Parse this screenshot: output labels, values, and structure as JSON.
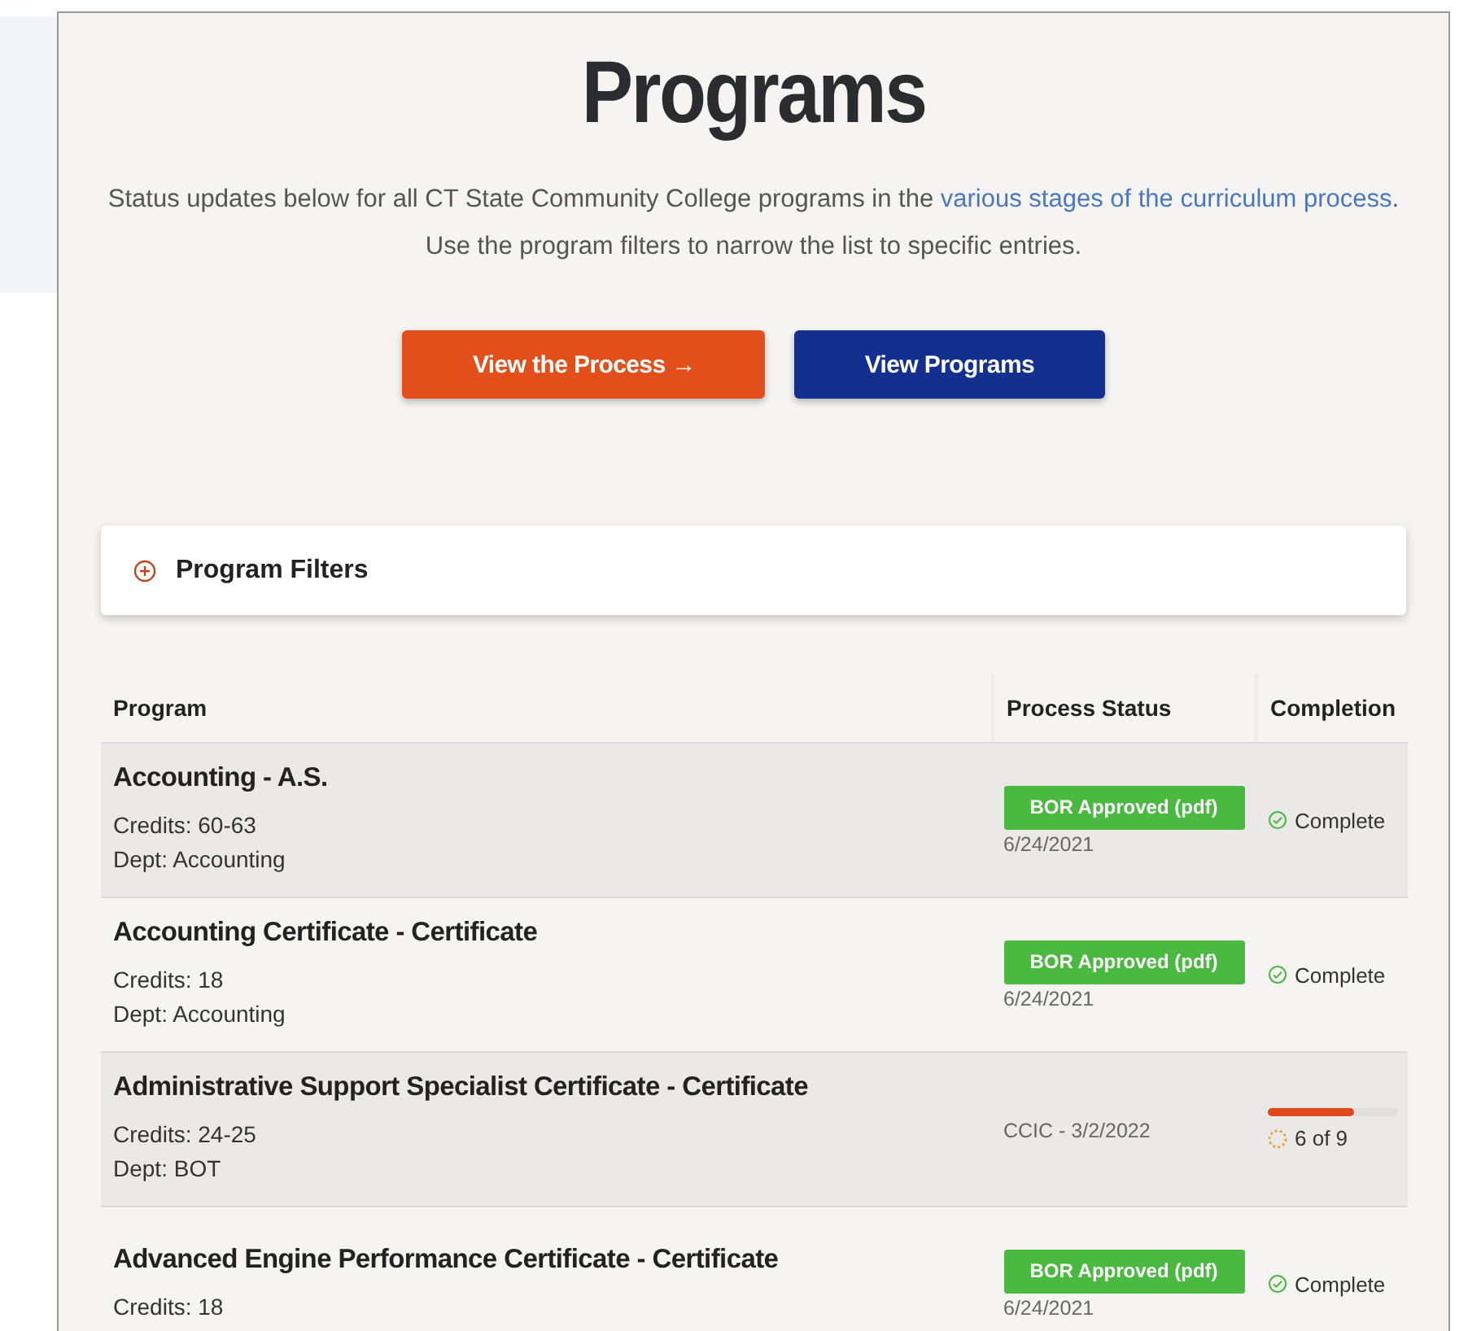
{
  "title": "Programs",
  "intro": {
    "text": "Status updates below for all CT State Community College programs in the ",
    "link": "various stages of the curriculum process",
    "after": ". Use the program filters to narrow the list to specific entries."
  },
  "buttons": [
    {
      "label": "View the Process →",
      "kind": "primary"
    },
    {
      "label": "View Programs",
      "kind": "secondary"
    }
  ],
  "filters": {
    "label": "Program Filters",
    "expanded": false
  },
  "table": {
    "columns": [
      "Program",
      "Process Status",
      "Completion"
    ],
    "rows": [
      {
        "name": "Accounting - A.S.",
        "credits": "Credits: 60-63",
        "dept": "Dept: Accounting",
        "kind": "approved",
        "status": "BOR Approved (pdf)",
        "date": "6/24/2021",
        "completion": "Complete"
      },
      {
        "name": "Accounting Certificate - Certificate",
        "credits": "Credits: 18",
        "dept": "Dept: Accounting",
        "kind": "approved",
        "status": "BOR Approved (pdf)",
        "date": "6/24/2021",
        "completion": "Complete"
      },
      {
        "name": "Administrative Support Specialist Certificate - Certificate",
        "credits": "Credits: 24-25",
        "dept": "Dept: BOT",
        "kind": "progress",
        "status": "CCIC - 3/2/2022",
        "level": 0.667,
        "completion": "6 of 9"
      },
      {
        "name": "Advanced Engine Performance Certificate - Certificate",
        "credits": "Credits: 18",
        "kind": "approved",
        "status": "BOR Approved (pdf)",
        "date": "6/24/2021",
        "completion": "Complete"
      }
    ]
  }
}
